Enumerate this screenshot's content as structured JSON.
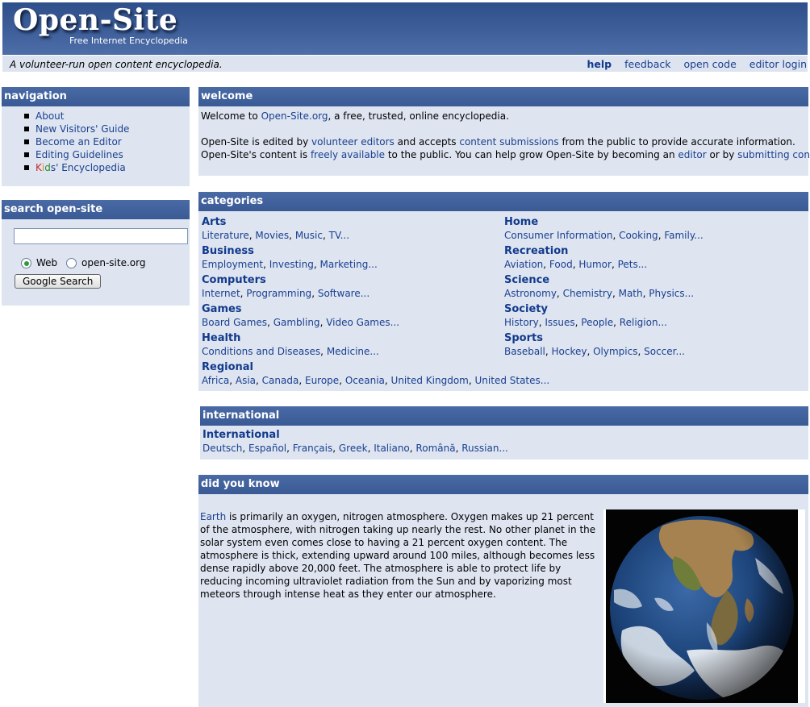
{
  "header": {
    "logo": "Open-Site",
    "tagline": "Free Internet Encyclopedia",
    "motto": "A volunteer-run open content encyclopedia.",
    "links": [
      {
        "label": "help"
      },
      {
        "label": "feedback"
      },
      {
        "label": "open code"
      },
      {
        "label": "editor login"
      }
    ]
  },
  "navigation": {
    "title": "navigation",
    "items": [
      "About",
      "New Visitors' Guide",
      "Become an Editor",
      "Editing Guidelines"
    ],
    "kids": {
      "k": "K",
      "i": "i",
      "d": "d",
      "rest": "s' Encyclopedia"
    }
  },
  "search": {
    "title": "search open-site",
    "input_value": "",
    "options": [
      "Web",
      "open-site.org"
    ],
    "selected": "Web",
    "button_label": "Google Search"
  },
  "welcome": {
    "title": "welcome",
    "l1": [
      "Welcome to ",
      "Open-Site.org",
      ", a free, trusted, online encyclopedia."
    ],
    "l2": [
      "Open-Site is edited by ",
      "volunteer editors",
      " and accepts ",
      "content submissions",
      " from the public to provide accurate information."
    ],
    "l3": [
      "Open-Site's content is ",
      "freely available",
      " to the public. You can help grow Open-Site by becoming an ",
      "editor",
      " or by ",
      "submitting content",
      "."
    ]
  },
  "categories": {
    "title": "categories",
    "left": [
      {
        "name": "Arts",
        "links": [
          "Literature",
          "Movies",
          "Music",
          "TV"
        ]
      },
      {
        "name": "Business",
        "links": [
          "Employment",
          "Investing",
          "Marketing"
        ]
      },
      {
        "name": "Computers",
        "links": [
          "Internet",
          "Programming",
          "Software"
        ]
      },
      {
        "name": "Games",
        "links": [
          "Board Games",
          "Gambling",
          "Video Games"
        ]
      },
      {
        "name": "Health",
        "links": [
          "Conditions and Diseases",
          "Medicine"
        ]
      },
      {
        "name": "Regional",
        "links": [
          "Africa",
          "Asia",
          "Canada",
          "Europe",
          "Oceania",
          "United Kingdom",
          "United States"
        ]
      }
    ],
    "right": [
      {
        "name": "Home",
        "links": [
          "Consumer Information",
          "Cooking",
          "Family"
        ]
      },
      {
        "name": "Recreation",
        "links": [
          "Aviation",
          "Food",
          "Humor",
          "Pets"
        ]
      },
      {
        "name": "Science",
        "links": [
          "Astronomy",
          "Chemistry",
          "Math",
          "Physics"
        ]
      },
      {
        "name": "Society",
        "links": [
          "History",
          "Issues",
          "People",
          "Religion"
        ]
      },
      {
        "name": "Sports",
        "links": [
          "Baseball",
          "Hockey",
          "Olympics",
          "Soccer"
        ]
      }
    ],
    "ellipsis": "...",
    "sep": ", "
  },
  "international": {
    "title": "international",
    "heading": "International",
    "links": [
      "Deutsch",
      "Español",
      "Français",
      "Greek",
      "Italiano",
      "Română",
      "Russian"
    ]
  },
  "didyouknow": {
    "title": "did you know",
    "link": "Earth",
    "text": " is primarily an oxygen, nitrogen atmosphere. Oxygen makes up 21 percent of the atmosphere, with nitrogen taking up nearly the rest. No other planet in the solar system even comes close to having a 21 percent oxygen content. The atmosphere is thick, extending upward around 100 miles, although becomes less dense rapidly above 20,000 feet. The atmosphere is able to protect life by reducing incoming ultraviolet radiation from the Sun and by vaporizing most meteors through intense heat as they enter our atmosphere."
  }
}
